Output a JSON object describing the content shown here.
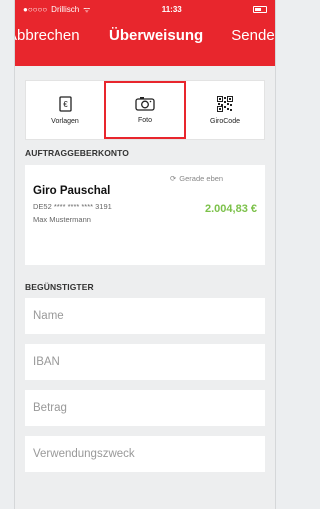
{
  "status_bar": {
    "carrier": "Drillisch",
    "time": "11:33"
  },
  "nav": {
    "left": "Abbrechen",
    "title": "Überweisung",
    "right": "Senden"
  },
  "toolbar": {
    "items": [
      {
        "label": "Vorlagen",
        "icon": "document-icon"
      },
      {
        "label": "Foto",
        "icon": "camera-icon"
      },
      {
        "label": "GiroCode",
        "icon": "qr-code-icon"
      }
    ]
  },
  "account_section": {
    "label": "AUFTRAGGEBERKONTO",
    "sync_text": "Gerade eben",
    "name": "Giro Pauschal",
    "iban": "DE52 **** **** **** 3191",
    "owner": "Max Mustermann",
    "balance": "2.004,83 €"
  },
  "recipient_section": {
    "label": "BEGÜNSTIGTER",
    "fields": [
      {
        "placeholder": "Name"
      },
      {
        "placeholder": "IBAN"
      },
      {
        "placeholder": "Betrag"
      },
      {
        "placeholder": "Verwendungszweck"
      }
    ]
  },
  "colors": {
    "brand_red": "#e8262d",
    "balance_green": "#7cc14a"
  }
}
